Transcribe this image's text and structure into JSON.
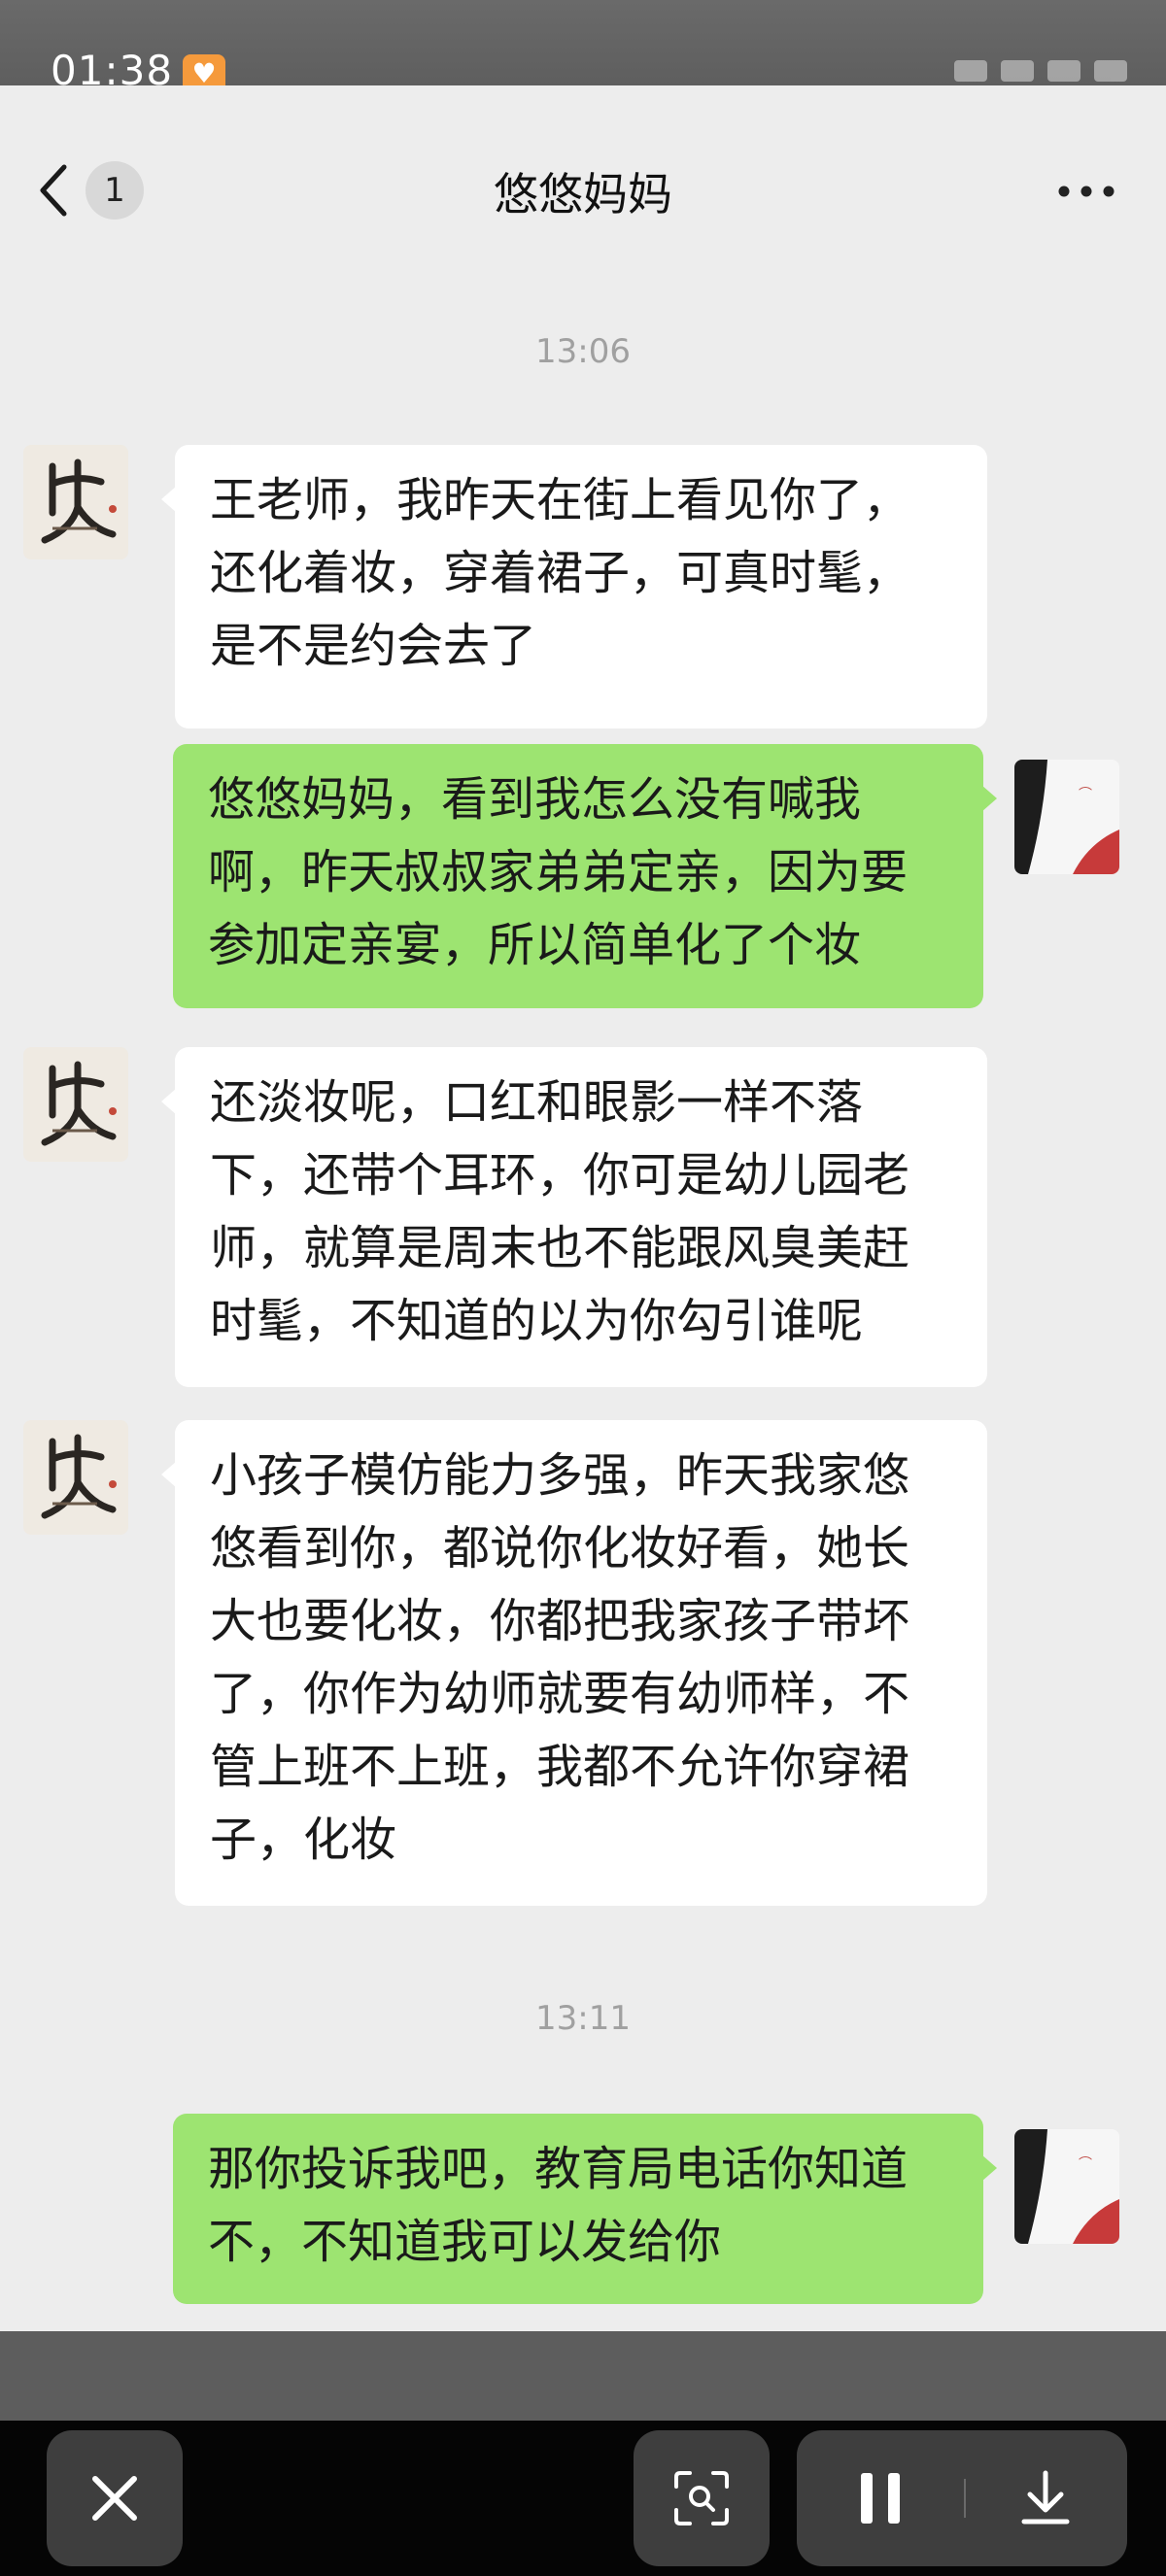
{
  "status_bar": {
    "time": "01:38"
  },
  "header": {
    "unread_count": "1",
    "title": "悠悠妈妈"
  },
  "timestamps": [
    "13:06",
    "13:11"
  ],
  "messages": [
    {
      "sender": "them",
      "text": "王老师，我昨天在街上看见你了，\n还化着妆，穿着裙子，可真时髦，\n是不是约会去了"
    },
    {
      "sender": "me",
      "text": "悠悠妈妈，看到我怎么没有喊我\n啊，昨天叔叔家弟弟定亲，因为要\n参加定亲宴，所以简单化了个妆"
    },
    {
      "sender": "them",
      "text": "还淡妆呢，口红和眼影一样不落\n下，还带个耳环，你可是幼儿园老\n师，就算是周末也不能跟风臭美赶\n时髦，不知道的以为你勾引谁呢"
    },
    {
      "sender": "them",
      "text": "小孩子模仿能力多强，昨天我家悠\n悠看到你，都说你化妆好看，她长\n大也要化妆，你都把我家孩子带坏\n了，你作为幼师就要有幼师样，不\n管上班不上班，我都不允许你穿裙\n子，化妆"
    },
    {
      "sender": "me",
      "text": "那你投诉我吧，教育局电话你知道\n不，不知道我可以发给你"
    }
  ],
  "colors": {
    "chat_background": "#ededed",
    "bubble_self": "#9de471",
    "bubble_other": "#ffffff",
    "timestamp": "#a0a0a0"
  },
  "icons": {
    "back": "chevron-left-icon",
    "more": "more-dots-icon",
    "close": "close-icon",
    "scan": "screenshot-scan-icon",
    "pause": "pause-icon",
    "download": "download-icon"
  }
}
